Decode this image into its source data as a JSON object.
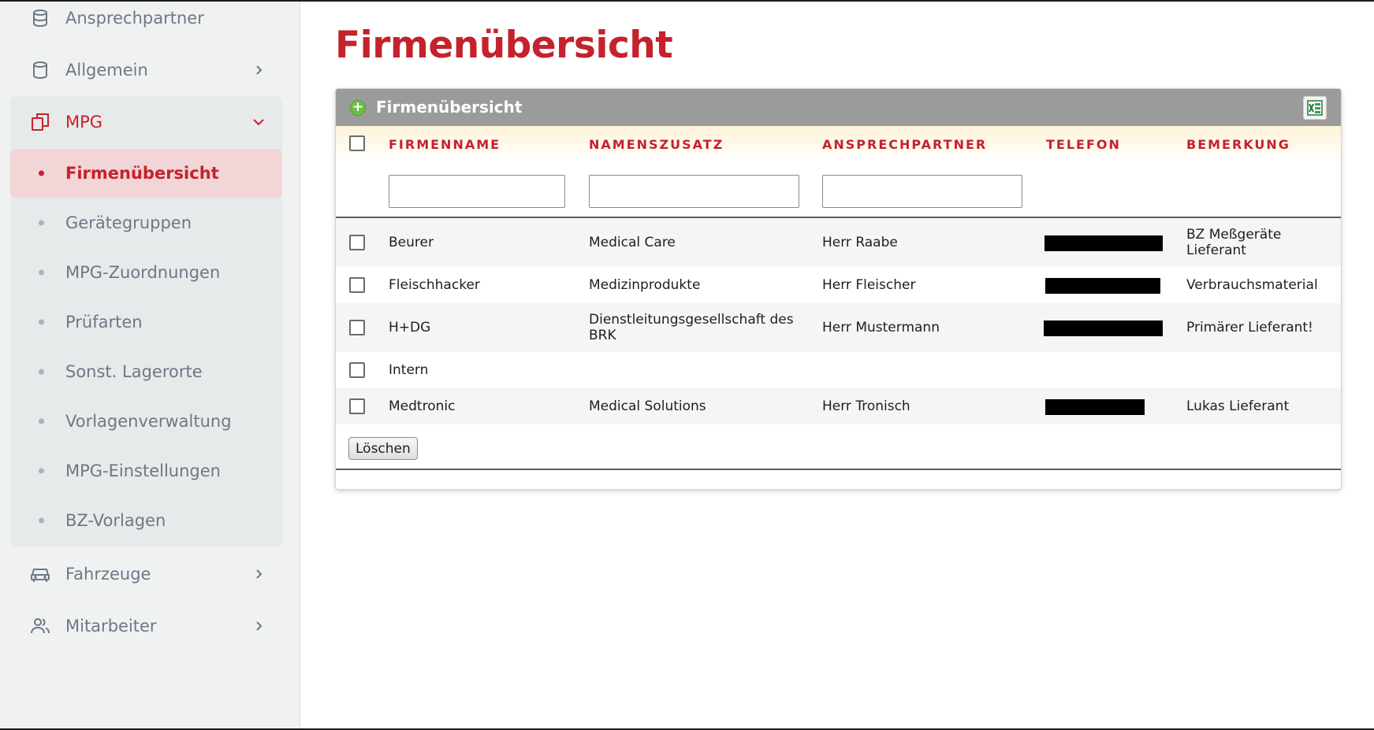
{
  "sidebar": {
    "items_top": [
      {
        "label": "Ansprechpartner",
        "icon": "database-icon"
      },
      {
        "label": "Allgemein",
        "icon": "cylinder-icon"
      },
      {
        "label": "MPG",
        "icon": "copy-icon"
      }
    ],
    "mpg_sub": [
      "Firmenübersicht",
      "Gerätegruppen",
      "MPG-Zuordnungen",
      "Prüfarten",
      "Sonst. Lagerorte",
      "Vorlagenverwaltung",
      "MPG-Einstellungen",
      "BZ-Vorlagen"
    ],
    "items_bottom": [
      {
        "label": "Fahrzeuge",
        "icon": "car-icon"
      },
      {
        "label": "Mitarbeiter",
        "icon": "users-icon"
      }
    ],
    "active_sub": "Firmenübersicht"
  },
  "page": {
    "title": "Firmenübersicht"
  },
  "panel": {
    "title": "Firmenübersicht",
    "columns": [
      "FIRMENNAME",
      "NAMENSZUSATZ",
      "ANSPRECHPARTNER",
      "TELEFON",
      "BEMERKUNG"
    ],
    "rows": [
      {
        "firmenname": "Beurer",
        "namenszusatz": "Medical Care",
        "ansprechpartner": "Herr Raabe",
        "bemerkung_1": "BZ Meßgeräte",
        "bemerkung_2": "Lieferant"
      },
      {
        "firmenname": "Fleischhacker",
        "namenszusatz": "Medizinprodukte",
        "ansprechpartner": "Herr Fleischer",
        "bemerkung_1": "Verbrauchsmaterial",
        "bemerkung_2": ""
      },
      {
        "firmenname": "H+DG",
        "namenszusatz": "Dienstleitungsgesellschaft des",
        "namenszusatz_2": "BRK",
        "ansprechpartner": "Herr Mustermann",
        "bemerkung_1": "Primärer Lieferant!",
        "bemerkung_2": ""
      },
      {
        "firmenname": "Intern",
        "namenszusatz": "",
        "ansprechpartner": "",
        "bemerkung_1": "",
        "bemerkung_2": ""
      },
      {
        "firmenname": "Medtronic",
        "namenszusatz": "Medical Solutions",
        "ansprechpartner": "Herr Tronisch",
        "bemerkung_1": "Lukas Lieferant",
        "bemerkung_2": ""
      }
    ],
    "delete_label": "Löschen"
  },
  "colors": {
    "accent": "#c4222c",
    "sidebar_bg": "#f0f2f1",
    "panel_header": "#9b9b9b"
  }
}
